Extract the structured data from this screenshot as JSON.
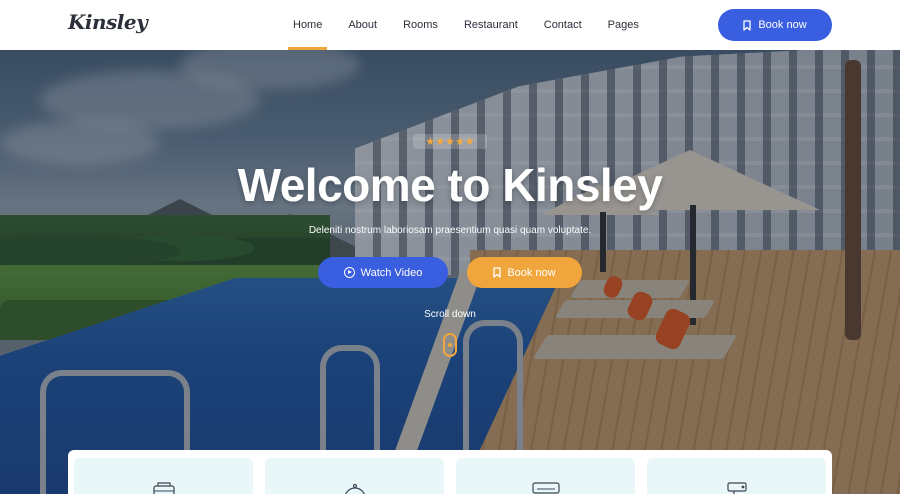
{
  "brand": {
    "logo": "Kinsley"
  },
  "nav": {
    "items": [
      {
        "label": "Home",
        "active": true
      },
      {
        "label": "About"
      },
      {
        "label": "Rooms"
      },
      {
        "label": "Restaurant"
      },
      {
        "label": "Contact"
      },
      {
        "label": "Pages"
      }
    ],
    "book_button": "Book now"
  },
  "hero": {
    "rating_stars": "★★★★★",
    "title": "Welcome to Kinsley",
    "subtitle": "Deleniti nostrum laboriosam praesentium quasi quam voluptate.",
    "watch_video": "Watch Video",
    "book_now": "Book now",
    "scroll_label": "Scroll down"
  },
  "features": {
    "icons": [
      "concierge-bell-icon",
      "dish-cloche-icon",
      "air-conditioner-icon",
      "security-camera-icon"
    ]
  },
  "colors": {
    "primary": "#3a5ee0",
    "accent": "#f0a63c",
    "nav_text": "#2b2f3a",
    "card_bg": "#eaf7f9"
  }
}
